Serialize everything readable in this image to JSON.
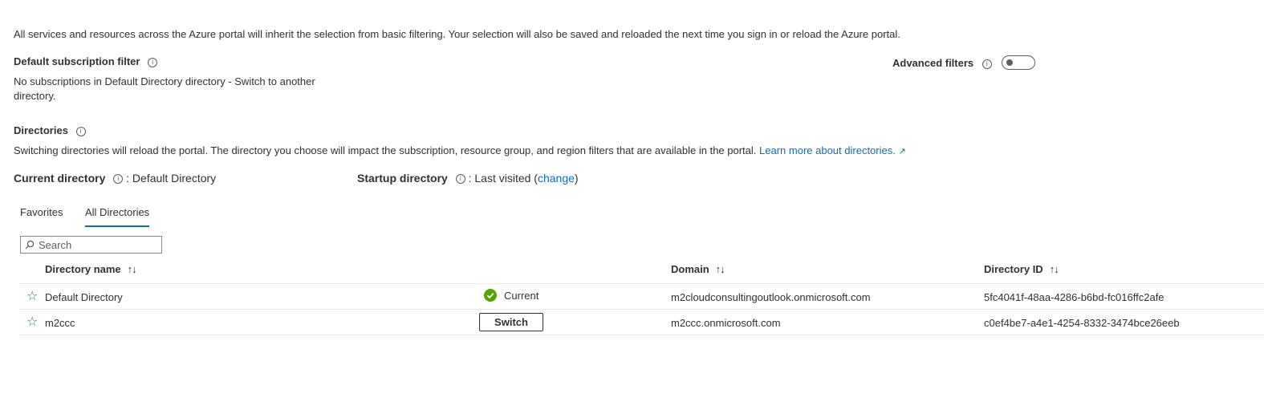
{
  "intro_text": "All services and resources across the Azure portal will inherit the selection from basic filtering. Your selection will also be saved and reloaded the next time you sign in or reload the Azure portal.",
  "subscription_filter": {
    "heading": "Default subscription filter",
    "message_line1": "No subscriptions in Default Directory directory - Switch to another",
    "message_line2": "directory."
  },
  "advanced_filters": {
    "label": "Advanced filters",
    "enabled": false
  },
  "directories": {
    "heading": "Directories",
    "description": "Switching directories will reload the portal. The directory you choose will impact the subscription, resource group, and region filters that are available in the portal.",
    "learn_more": "Learn more about directories.",
    "current_label": "Current directory",
    "current_value": ": Default Directory",
    "startup_label": "Startup directory",
    "startup_value": ": Last visited (",
    "startup_change": "change",
    "startup_close": ")"
  },
  "tabs": [
    {
      "label": "Favorites",
      "active": false
    },
    {
      "label": "All Directories",
      "active": true
    }
  ],
  "search": {
    "placeholder": "Search",
    "value": ""
  },
  "table": {
    "columns": [
      "Directory name",
      "Domain",
      "Directory ID"
    ],
    "sort_glyph": "↑↓",
    "rows": [
      {
        "name": "Default Directory",
        "status": "Current",
        "domain": "m2cloudconsultingoutlook.onmicrosoft.com",
        "id": "5fc4041f-48aa-4286-b6bd-fc016ffc2afe"
      },
      {
        "name": "m2ccc",
        "action": "Switch",
        "domain": "m2ccc.onmicrosoft.com",
        "id": "c0ef4be7-a4e1-4254-8332-3474bce26eeb"
      }
    ]
  },
  "icons": {
    "info": "info-icon",
    "star": "star-outline-icon",
    "check": "checkmark-circle-icon",
    "external": "external-link-icon",
    "search": "search-icon"
  },
  "colors": {
    "link": "#0f6cbd",
    "success": "#57a300",
    "text": "#323130"
  }
}
